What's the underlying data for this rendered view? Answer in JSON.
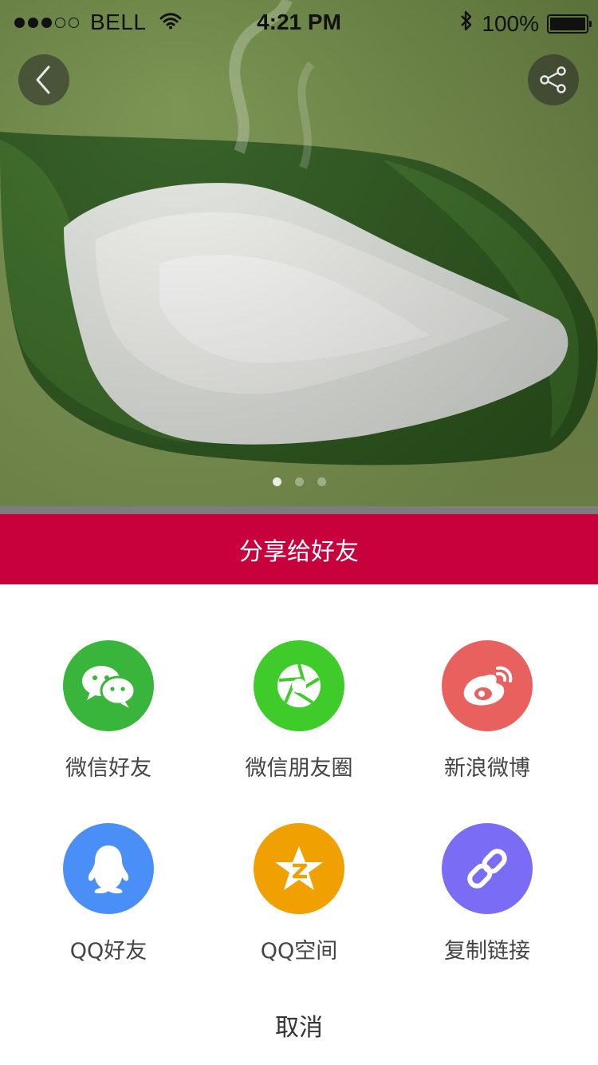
{
  "status_bar": {
    "carrier": "BELL",
    "time": "4:21 PM",
    "battery": "100%",
    "battery_level": 1.0
  },
  "hero": {
    "carousel_total": 3,
    "carousel_active": 0,
    "colors": {
      "background": "#7c9550"
    }
  },
  "share_sheet": {
    "title": "分享给好友",
    "cancel_label": "取消",
    "colors": {
      "header": "#c8003b"
    },
    "items": [
      {
        "label": "微信好友",
        "icon": "wechat-icon",
        "color": "#39b53c"
      },
      {
        "label": "微信朋友圈",
        "icon": "moments-icon",
        "color": "#3fcc2b"
      },
      {
        "label": "新浪微博",
        "icon": "weibo-icon",
        "color": "#e8615f"
      },
      {
        "label": "QQ好友",
        "icon": "qq-icon",
        "color": "#4a8ef7"
      },
      {
        "label": "QQ空间",
        "icon": "qzone-icon",
        "color": "#f0a000"
      },
      {
        "label": "复制链接",
        "icon": "link-icon",
        "color": "#7b6cf5"
      }
    ]
  }
}
